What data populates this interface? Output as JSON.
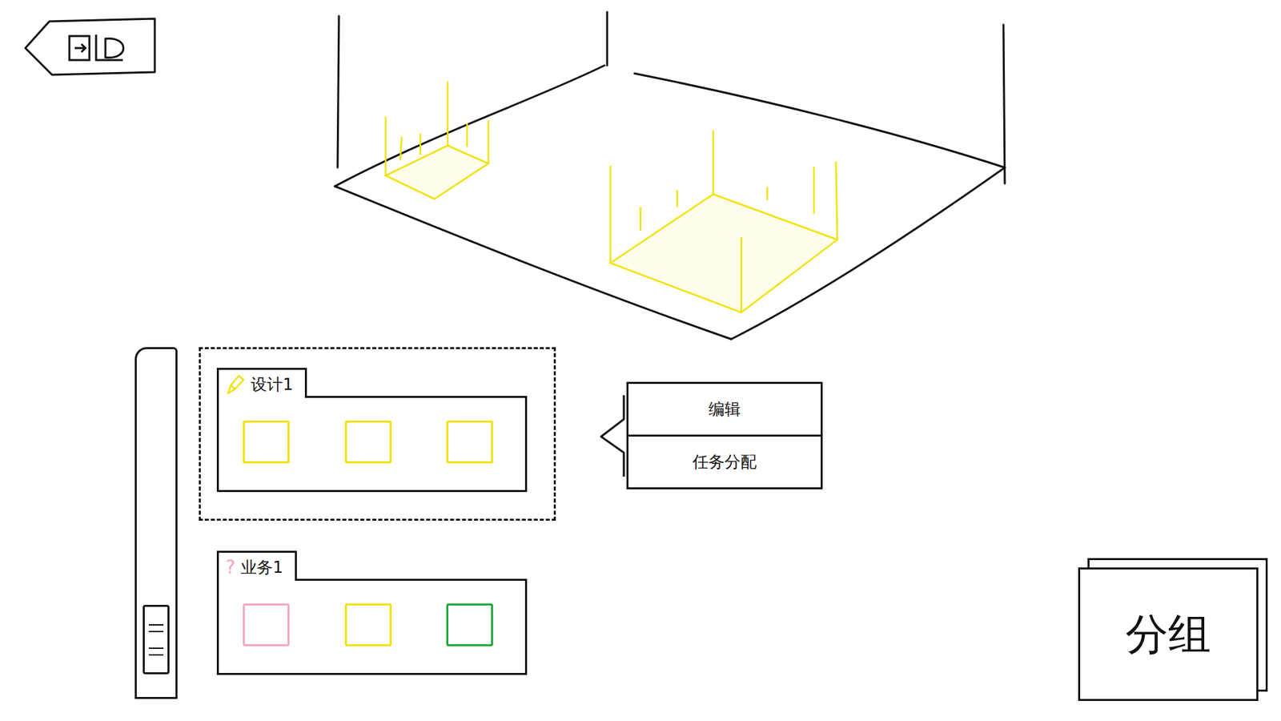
{
  "groups": [
    {
      "name": "设计1",
      "kind": "edit",
      "icon_text": "",
      "selected": true,
      "color": "#f2e200",
      "members": [
        {
          "color": "#f2e200"
        },
        {
          "color": "#f2e200"
        },
        {
          "color": "#f2e200"
        }
      ]
    },
    {
      "name": "业务1",
      "kind": "question",
      "icon_text": "?",
      "selected": false,
      "color": "#f4a6c4",
      "members": [
        {
          "color": "#f4a6c4"
        },
        {
          "color": "#f2e200"
        },
        {
          "color": "#1fa83a"
        }
      ]
    }
  ],
  "context_menu": {
    "items": [
      {
        "label": "编辑"
      },
      {
        "label": "任务分配"
      }
    ]
  },
  "group_button": {
    "label": "分组"
  }
}
